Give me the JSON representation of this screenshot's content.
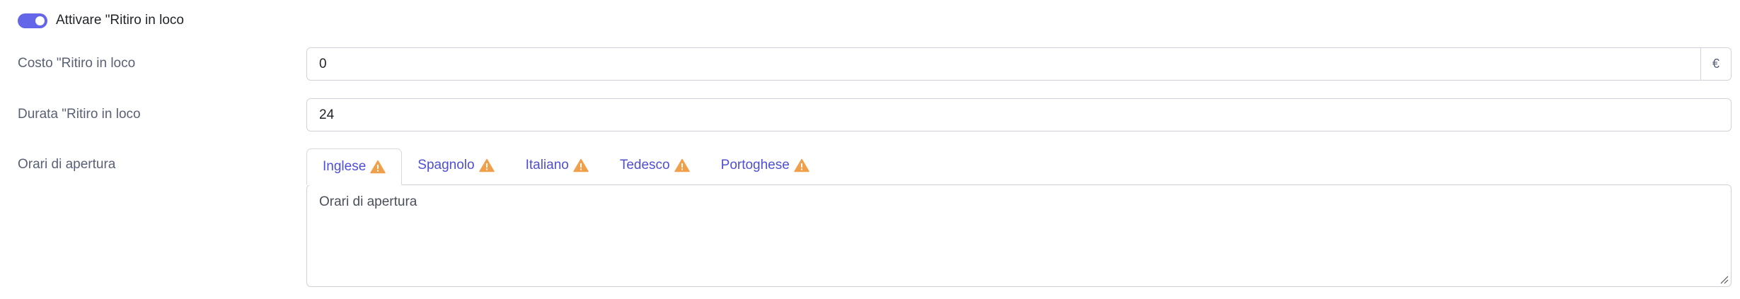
{
  "pickup_toggle": {
    "label": "Attivare \"Ritiro in loco",
    "enabled": true,
    "accent_color": "#6466e9"
  },
  "cost_field": {
    "label": "Costo \"Ritiro in loco",
    "value": "0",
    "currency_symbol": "€"
  },
  "duration_field": {
    "label": "Durata \"Ritiro in loco",
    "value": "24"
  },
  "opening_hours": {
    "label": "Orari di apertura",
    "tabs": [
      {
        "label": "Inglese",
        "active": true,
        "icon": "warning-icon"
      },
      {
        "label": "Spagnolo",
        "active": false,
        "icon": "warning-icon"
      },
      {
        "label": "Italiano",
        "active": false,
        "icon": "warning-icon"
      },
      {
        "label": "Tedesco",
        "active": false,
        "icon": "warning-icon"
      },
      {
        "label": "Portoghese",
        "active": false,
        "icon": "warning-icon"
      }
    ],
    "textarea_placeholder": "Orari di apertura",
    "warning_color": "#f0a04b",
    "tab_link_color": "#4e4fd6"
  }
}
